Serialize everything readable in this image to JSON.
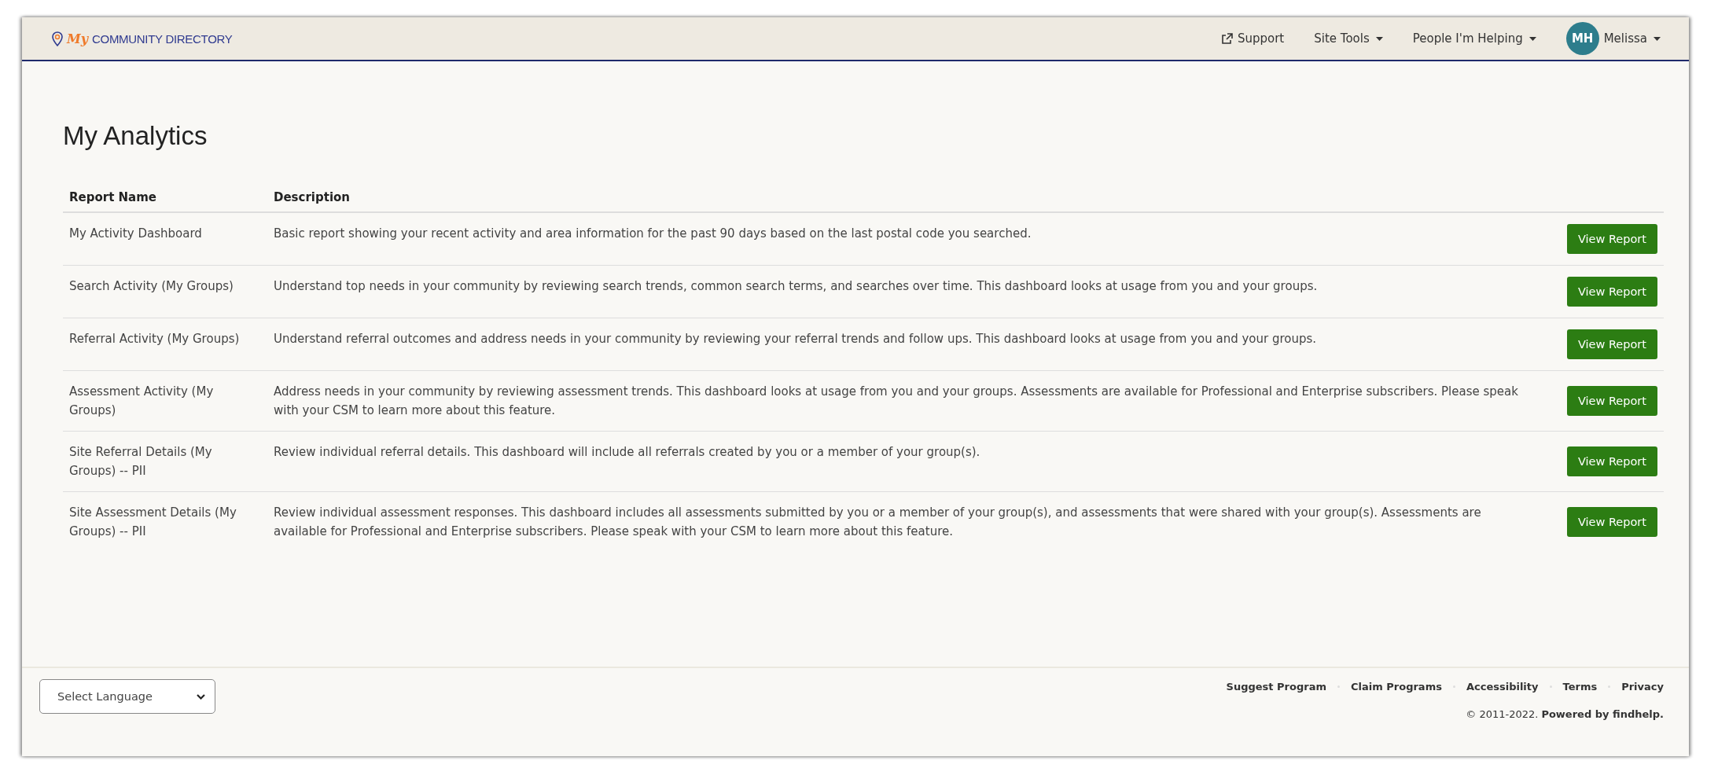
{
  "header": {
    "logo_mark": "My",
    "logo_text": "COMMUNITY DIRECTORY",
    "nav": [
      {
        "label": "Support",
        "kind": "external"
      },
      {
        "label": "Site Tools",
        "kind": "dropdown"
      },
      {
        "label": "People I'm Helping",
        "kind": "dropdown"
      }
    ],
    "user": {
      "initials": "MH",
      "name": "Melissa"
    }
  },
  "page_title": "My Analytics",
  "table": {
    "columns": [
      "Report Name",
      "Description"
    ],
    "rows": [
      {
        "name": "My Activity Dashboard",
        "description": "Basic report showing your recent activity and area information for the past 90 days based on the last postal code you searched.",
        "action": "View Report"
      },
      {
        "name": "Search Activity (My Groups)",
        "description": "Understand top needs in your community by reviewing search trends, common search terms, and searches over time. This dashboard looks at usage from you and your groups.",
        "action": "View Report"
      },
      {
        "name": "Referral Activity (My Groups)",
        "description": "Understand referral outcomes and address needs in your community by reviewing your referral trends and follow ups. This dashboard looks at usage from you and your groups.",
        "action": "View Report"
      },
      {
        "name": "Assessment Activity (My Groups)",
        "description": "Address needs in your community by reviewing assessment trends. This dashboard looks at usage from you and your groups. Assessments are available for Professional and Enterprise subscribers. Please speak with your CSM to learn more about this feature.",
        "action": "View Report"
      },
      {
        "name": "Site Referral Details (My Groups) -- PII",
        "description": "Review individual referral details. This dashboard will include all referrals created by you or a member of your group(s).",
        "action": "View Report"
      },
      {
        "name": "Site Assessment Details (My Groups) -- PII",
        "description": "Review individual assessment responses. This dashboard includes all assessments submitted by you or a member of your group(s), and assessments that were shared with your group(s). Assessments are available for Professional and Enterprise subscribers. Please speak with your CSM to learn more about this feature.",
        "action": "View Report"
      }
    ]
  },
  "footer": {
    "language_select": "Select Language",
    "links": [
      "Suggest Program",
      "Claim Programs",
      "Accessibility",
      "Terms",
      "Privacy"
    ],
    "copyright": "© 2011-2022.",
    "powered_by": "Powered by findhelp."
  }
}
